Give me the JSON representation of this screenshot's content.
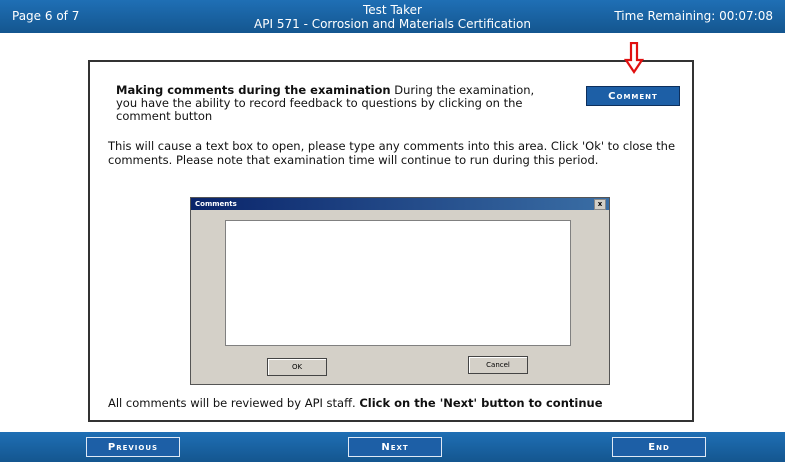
{
  "header": {
    "page": "Page 6 of 7",
    "title_line1": "Test Taker",
    "title_line2": "API 571 - Corrosion and Materials Certification",
    "time": "Time Remaining: 00:07:08"
  },
  "panel": {
    "intro_bold": "Making comments during the examination",
    "intro_rest": " During the examination, you have the ability to record feedback to questions by clicking on the comment button",
    "comment_button": "Comment",
    "paragraph": "This will cause a text box to open, please type any comments into this area. Click 'Ok' to close the comments. Please note that examination time will continue to run during this period.",
    "footer_normal": "All comments will be reviewed by API staff. ",
    "footer_bold": "Click on the 'Next' button to continue"
  },
  "dialog": {
    "title": "Comments",
    "close": "x",
    "ok": "OK",
    "cancel": "Cancel"
  },
  "nav": {
    "previous": "Previous",
    "next": "Next",
    "end": "End"
  },
  "colors": {
    "bar": "#1a63a6",
    "arrow": "#e01010"
  }
}
